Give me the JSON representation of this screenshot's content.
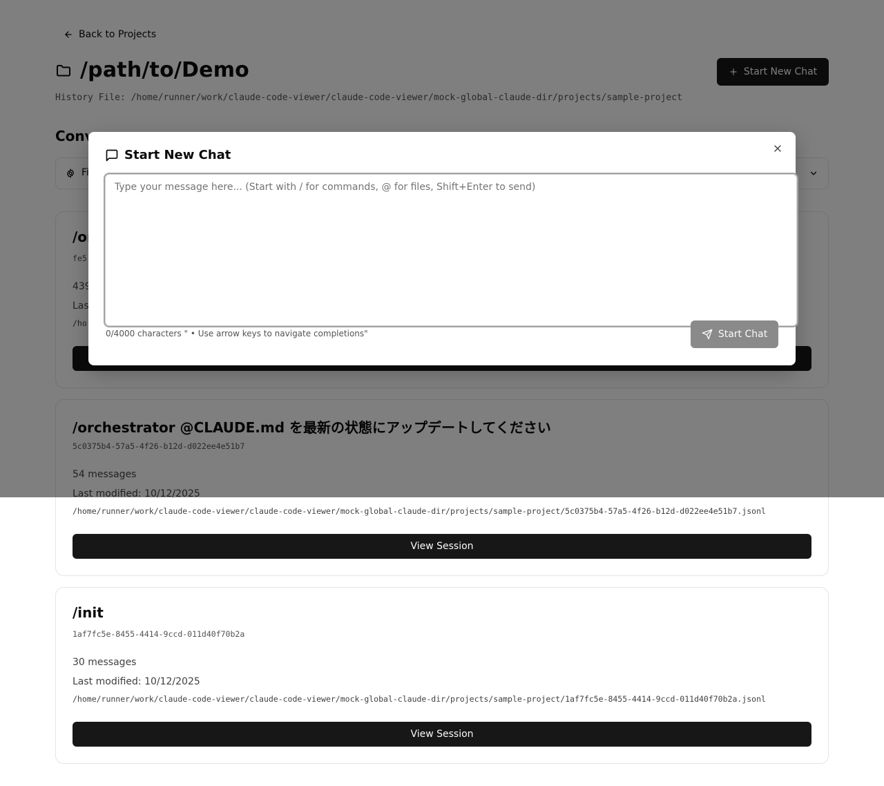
{
  "nav": {
    "back_label": "Back to Projects"
  },
  "project": {
    "title": "/path/to/Demo",
    "history_label": "History File: /home/runner/work/claude-code-viewer/claude-code-viewer/mock-global-claude-dir/projects/sample-project",
    "new_chat_label": "Start New Chat"
  },
  "sessions_section": {
    "title": "Conv",
    "filter_label": "Fi"
  },
  "sessions": [
    {
      "title": "/or",
      "id": "fe5",
      "count": "439",
      "modified": "Las",
      "path": "/ho",
      "button": ""
    },
    {
      "title": "/orchestrator @CLAUDE.md を最新の状態にアップデートしてください",
      "id": "5c0375b4-57a5-4f26-b12d-d022ee4e51b7",
      "count": "54 messages",
      "modified": "Last modified: 10/12/2025",
      "path": "/home/runner/work/claude-code-viewer/claude-code-viewer/mock-global-claude-dir/projects/sample-project/5c0375b4-57a5-4f26-b12d-d022ee4e51b7.jsonl",
      "button": "View Session"
    },
    {
      "title": "/init",
      "id": "1af7fc5e-8455-4414-9ccd-011d40f70b2a",
      "count": "30 messages",
      "modified": "Last modified: 10/12/2025",
      "path": "/home/runner/work/claude-code-viewer/claude-code-viewer/mock-global-claude-dir/projects/sample-project/1af7fc5e-8455-4414-9ccd-011d40f70b2a.jsonl",
      "button": "View Session"
    }
  ],
  "modal": {
    "title": "Start New Chat",
    "placeholder": "Type your message here... (Start with / for commands, @ for files, Shift+Enter to send)",
    "value": "",
    "hint": "0/4000 characters \" • Use arrow keys to navigate completions\"",
    "submit_label": "Start Chat"
  },
  "icons": {
    "back": "arrow-left-icon",
    "folder": "folder-icon",
    "plus": "plus-icon",
    "gear": "gear-icon",
    "chevron": "chevron-down-icon",
    "chat": "message-square-icon",
    "close": "close-icon",
    "send": "send-icon"
  }
}
